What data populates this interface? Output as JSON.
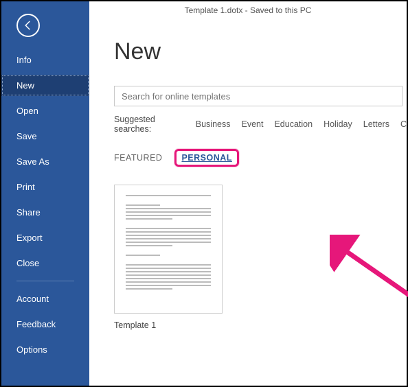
{
  "titlebar": "Template 1.dotx - Saved to this PC",
  "sidebar": {
    "items": [
      {
        "label": "Info"
      },
      {
        "label": "New"
      },
      {
        "label": "Open"
      },
      {
        "label": "Save"
      },
      {
        "label": "Save As"
      },
      {
        "label": "Print"
      },
      {
        "label": "Share"
      },
      {
        "label": "Export"
      },
      {
        "label": "Close"
      }
    ],
    "bottom": [
      {
        "label": "Account"
      },
      {
        "label": "Feedback"
      },
      {
        "label": "Options"
      }
    ]
  },
  "page": {
    "title": "New",
    "search_placeholder": "Search for online templates",
    "suggested_label": "Suggested searches:",
    "suggested": [
      "Business",
      "Event",
      "Education",
      "Holiday",
      "Letters",
      "C"
    ],
    "tabs": {
      "featured": "FEATURED",
      "personal": "PERSONAL"
    },
    "template": {
      "name": "Template 1"
    }
  }
}
